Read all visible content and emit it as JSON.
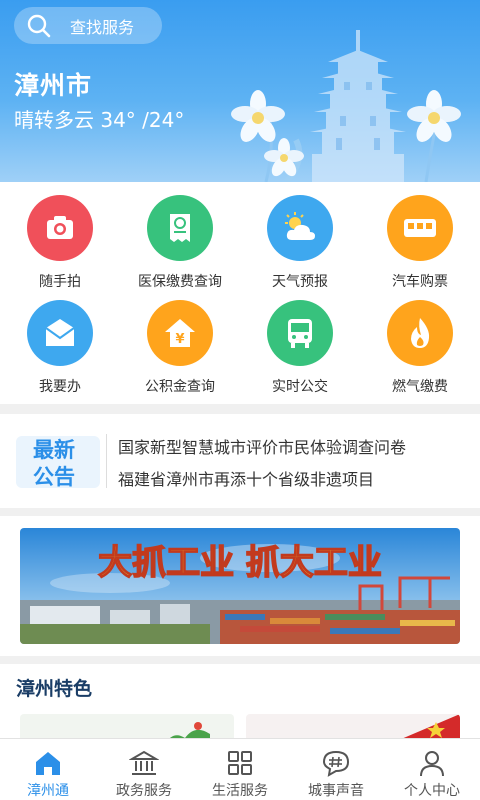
{
  "header": {
    "search_placeholder": "查找服务",
    "city": "漳州市",
    "weather": "晴转多云 34° /24°"
  },
  "services": [
    {
      "label": "随手拍",
      "icon": "camera-icon",
      "color": "#f0505a"
    },
    {
      "label": "医保缴费查询",
      "icon": "receipt-icon",
      "color": "#37c27d"
    },
    {
      "label": "天气预报",
      "icon": "weather-icon",
      "color": "#3ea8ef"
    },
    {
      "label": "汽车购票",
      "icon": "bus-ticket-icon",
      "color": "#ffa41c"
    },
    {
      "label": "我要办",
      "icon": "mail-icon",
      "color": "#3ea8ef"
    },
    {
      "label": "公积金查询",
      "icon": "house-yen-icon",
      "color": "#ffa41c"
    },
    {
      "label": "实时公交",
      "icon": "bus-icon",
      "color": "#37c27d"
    },
    {
      "label": "燃气缴费",
      "icon": "flame-icon",
      "color": "#ffa41c"
    }
  ],
  "notice": {
    "badge_line1": "最新",
    "badge_line2": "公告",
    "items": [
      "国家新型智慧城市评价市民体验调查问卷",
      "福建省漳州市再添十个省级非遗项目"
    ]
  },
  "banner": {
    "slogan": "大抓工业  抓大工业"
  },
  "feature": {
    "title": "漳州特色"
  },
  "tabs": [
    {
      "label": "漳州通",
      "icon": "home-icon",
      "active": true
    },
    {
      "label": "政务服务",
      "icon": "government-building-icon",
      "active": false
    },
    {
      "label": "生活服务",
      "icon": "grid-apps-icon",
      "active": false
    },
    {
      "label": "城事声音",
      "icon": "hashtag-bubble-icon",
      "active": false
    },
    {
      "label": "个人中心",
      "icon": "person-icon",
      "active": false
    }
  ],
  "colors": {
    "primary": "#2b8fe8",
    "header_top": "#3a9df0",
    "feature_title": "#1a3d66"
  }
}
